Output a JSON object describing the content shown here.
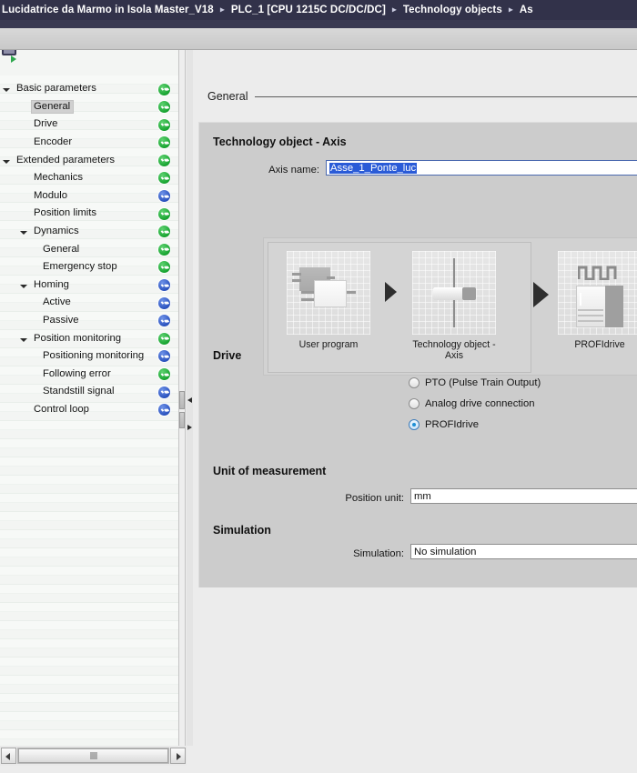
{
  "breadcrumb": {
    "items": [
      "Lucidatrice da Marmo in Isola Master_V18",
      "PLC_1 [CPU 1215C DC/DC/DC]",
      "Technology objects",
      "As"
    ],
    "separator": "▸"
  },
  "tree": {
    "items": [
      {
        "label": "Basic parameters",
        "level": 0,
        "twisty": "open",
        "badge": "ok",
        "selected": false
      },
      {
        "label": "General",
        "level": 1,
        "twisty": "none",
        "badge": "ok",
        "selected": true
      },
      {
        "label": "Drive",
        "level": 1,
        "twisty": "none",
        "badge": "ok",
        "selected": false
      },
      {
        "label": "Encoder",
        "level": 1,
        "twisty": "none",
        "badge": "ok",
        "selected": false
      },
      {
        "label": "Extended parameters",
        "level": 0,
        "twisty": "open",
        "badge": "ok",
        "selected": false
      },
      {
        "label": "Mechanics",
        "level": 1,
        "twisty": "none",
        "badge": "ok",
        "selected": false
      },
      {
        "label": "Modulo",
        "level": 1,
        "twisty": "none",
        "badge": "info",
        "selected": false
      },
      {
        "label": "Position limits",
        "level": 1,
        "twisty": "none",
        "badge": "ok",
        "selected": false
      },
      {
        "label": "Dynamics",
        "level": 1,
        "twisty": "open",
        "badge": "ok",
        "selected": false
      },
      {
        "label": "General",
        "level": 2,
        "twisty": "none",
        "badge": "ok",
        "selected": false
      },
      {
        "label": "Emergency stop",
        "level": 2,
        "twisty": "none",
        "badge": "ok",
        "selected": false
      },
      {
        "label": "Homing",
        "level": 1,
        "twisty": "open",
        "badge": "info",
        "selected": false
      },
      {
        "label": "Active",
        "level": 2,
        "twisty": "none",
        "badge": "info",
        "selected": false
      },
      {
        "label": "Passive",
        "level": 2,
        "twisty": "none",
        "badge": "info",
        "selected": false
      },
      {
        "label": "Position monitoring",
        "level": 1,
        "twisty": "open",
        "badge": "ok",
        "selected": false
      },
      {
        "label": "Positioning monitoring",
        "level": 2,
        "twisty": "none",
        "badge": "info",
        "selected": false
      },
      {
        "label": "Following error",
        "level": 2,
        "twisty": "none",
        "badge": "ok",
        "selected": false
      },
      {
        "label": "Standstill signal",
        "level": 2,
        "twisty": "none",
        "badge": "info",
        "selected": false
      },
      {
        "label": "Control loop",
        "level": 1,
        "twisty": "none",
        "badge": "info",
        "selected": false
      }
    ]
  },
  "content": {
    "title": "General",
    "technology_object": {
      "heading": "Technology object - Axis",
      "axis_name_label": "Axis name:",
      "axis_name_value": "Asse_1_Ponte_luc"
    },
    "diagram": {
      "tiles": [
        {
          "caption": "User program",
          "icon": "user-program-icon"
        },
        {
          "caption": "Technology object - Axis",
          "icon": "axis-icon"
        },
        {
          "caption": "PROFIdrive",
          "icon": "profidrive-icon"
        }
      ]
    },
    "drive": {
      "heading": "Drive",
      "options": [
        {
          "label": "PTO (Pulse Train Output)",
          "selected": false
        },
        {
          "label": "Analog drive connection",
          "selected": false
        },
        {
          "label": "PROFIdrive",
          "selected": true
        }
      ]
    },
    "unit_of_measurement": {
      "heading": "Unit of measurement",
      "position_unit_label": "Position unit:",
      "position_unit_value": "mm"
    },
    "simulation": {
      "heading": "Simulation",
      "label": "Simulation:",
      "value": "No simulation"
    }
  },
  "colors": {
    "breadcrumb_bg": "#32324a",
    "panel_bg": "#cccccc",
    "status_ok": "#17a430",
    "status_info": "#2a52be",
    "selection_blue": "#2a5bd7",
    "radio_accent": "#1e8fd5"
  }
}
